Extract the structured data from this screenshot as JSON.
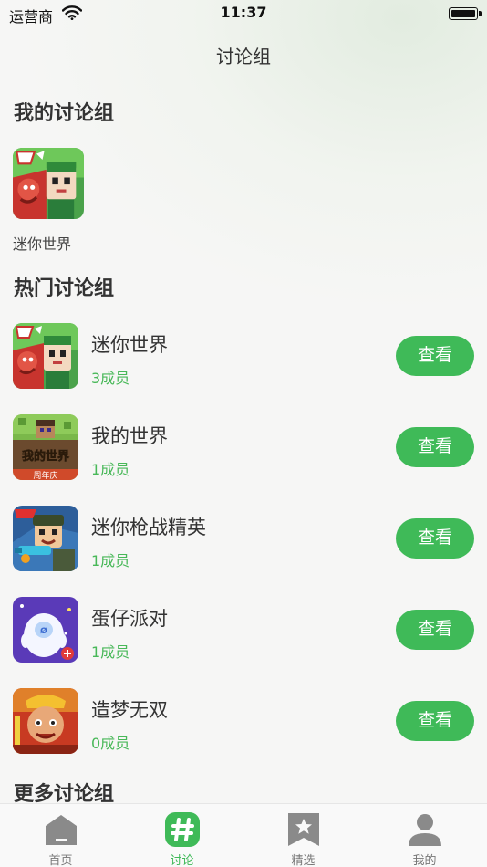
{
  "status_bar": {
    "carrier": "运营商",
    "time": "11:37"
  },
  "header": {
    "title": "讨论组"
  },
  "my_groups": {
    "title": "我的讨论组",
    "items": [
      {
        "name": "迷你世界",
        "icon": "mini-world-game-icon"
      }
    ]
  },
  "hot_groups": {
    "title": "热门讨论组",
    "items": [
      {
        "name": "迷你世界",
        "members": "3成员",
        "button": "查看",
        "icon": "mini-world-game-icon"
      },
      {
        "name": "我的世界",
        "members": "1成员",
        "button": "查看",
        "icon": "my-world-game-icon",
        "icon_text": "我的世界",
        "icon_badge": "周年庆"
      },
      {
        "name": "迷你枪战精英",
        "members": "1成员",
        "button": "查看",
        "icon": "mini-gun-elite-game-icon"
      },
      {
        "name": "蛋仔派对",
        "members": "1成员",
        "button": "查看",
        "icon": "eggy-party-game-icon"
      },
      {
        "name": "造梦无双",
        "members": "0成员",
        "button": "查看",
        "icon": "dream-warrior-game-icon"
      }
    ]
  },
  "more_groups": {
    "title": "更多讨论组"
  },
  "tab_bar": {
    "tabs": [
      {
        "label": "首页",
        "icon": "home-icon",
        "active": false
      },
      {
        "label": "讨论",
        "icon": "hashtag-icon",
        "active": true
      },
      {
        "label": "精选",
        "icon": "bookmark-star-icon",
        "active": false
      },
      {
        "label": "我的",
        "icon": "user-icon",
        "active": false
      }
    ]
  },
  "colors": {
    "accent": "#3fba58",
    "text": "#333333"
  }
}
